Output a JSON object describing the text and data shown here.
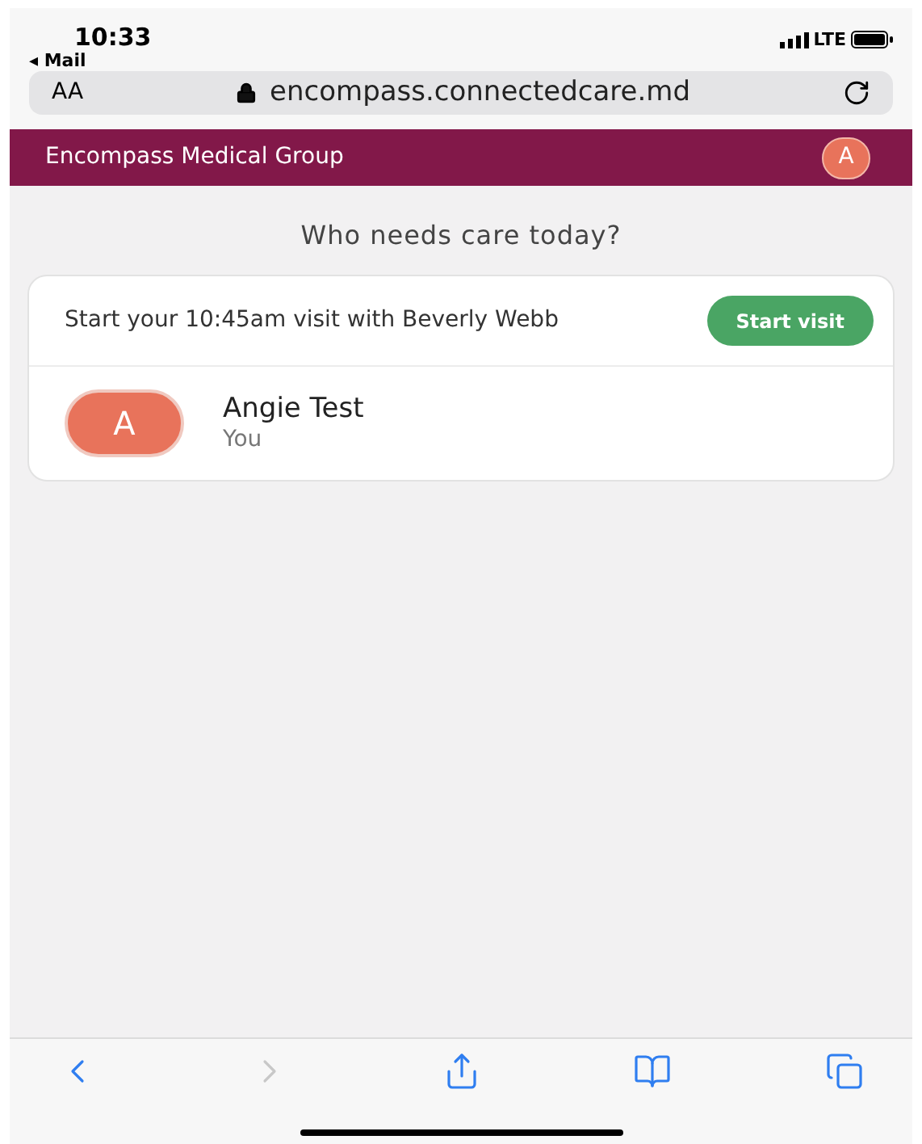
{
  "status_bar": {
    "time": "10:33",
    "back_app": "◂ Mail",
    "network": "LTE"
  },
  "address_bar": {
    "reader_label": "AA",
    "url": "encompass.connectedcare.md"
  },
  "header": {
    "title": "Encompass Medical Group",
    "avatar_letter": "A"
  },
  "heading": "Who needs care today?",
  "visit_banner": {
    "message": "Start your 10:45am visit with Beverly Webb",
    "button": "Start visit"
  },
  "patients": [
    {
      "initial": "A",
      "name": "Angie Test",
      "relation": "You"
    }
  ],
  "toolbar": [
    {
      "kind": "back",
      "disabled": false
    },
    {
      "kind": "forward",
      "disabled": true
    },
    {
      "kind": "share",
      "disabled": false
    },
    {
      "kind": "bookmarks",
      "disabled": false
    },
    {
      "kind": "tabs",
      "disabled": false
    }
  ]
}
